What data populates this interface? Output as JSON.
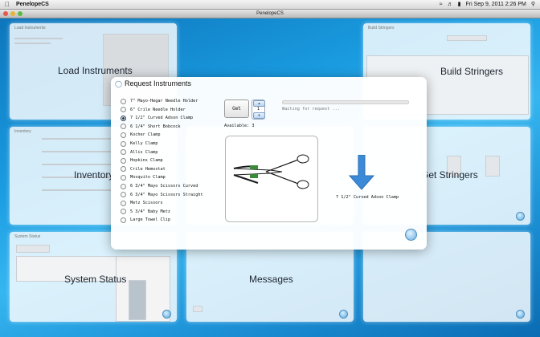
{
  "menubar": {
    "app": "PenelopeCS",
    "clock": "Fri Sep 9, 2011  2:26 PM"
  },
  "window": {
    "title": "PenelopeCS"
  },
  "panels": {
    "load": {
      "title": "Load Instruments",
      "label": "Load Instruments"
    },
    "build": {
      "title": "Build Stringers",
      "label": "Build Stringers"
    },
    "inventory": {
      "title": "Inventory",
      "label": "Inventory"
    },
    "get": {
      "label": "Get Stringers"
    },
    "system": {
      "title": "System Status",
      "label": "System Status"
    },
    "messages": {
      "label": "Messages"
    }
  },
  "modal": {
    "title": "Request Instruments",
    "instruments": [
      "7\" Mayo-Hegar Needle Holder",
      "6\" Crile Needle Holder",
      "7 1/2\" Curved Adson Clamp",
      "6 1/4\" Short Bobcock",
      "Kocher Clamp",
      "Kelly Clamp",
      "Allis Clamp",
      "Hopkins Clamp",
      "Crile Hemostat",
      "Mosquito Clamp",
      "6 3/4\" Mayo Scissors Curved",
      "6 3/4\" Mayo Scissors Straight",
      "Metz Scissors",
      "5 3/4\" Baby Metz",
      "Large Towel Clip"
    ],
    "selected_index": 2,
    "get_label": "Get",
    "quantity": "1",
    "available": "Available: 3",
    "status": "Waiting for request ...",
    "selected_name": "7 1/2\" Curved Adson Clamp"
  },
  "colors": {
    "arrow": "#3a8ad8",
    "accent": "#1a9be0"
  }
}
